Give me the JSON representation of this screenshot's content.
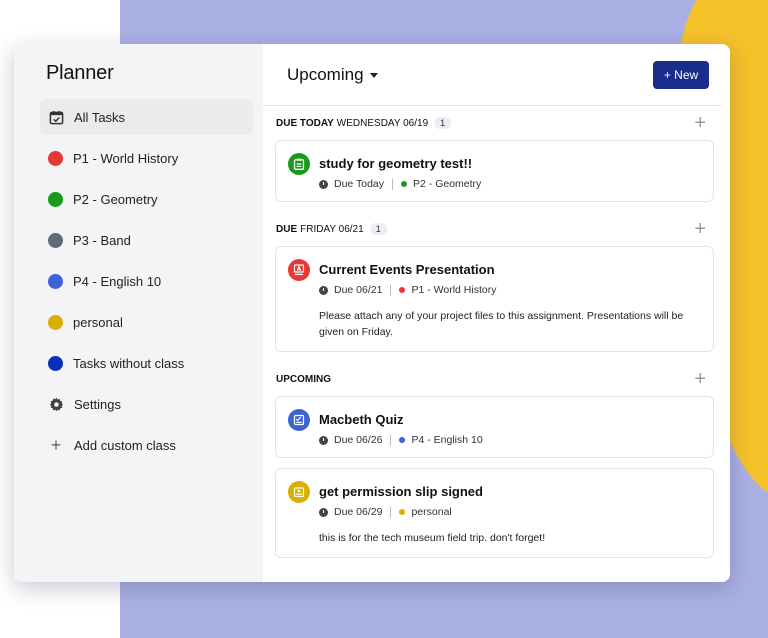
{
  "sidebar": {
    "title": "Planner",
    "items": [
      {
        "label": "All Tasks",
        "icon": "calendar-check-icon",
        "active": true
      },
      {
        "label": "P1 - World History",
        "color": "#e53935"
      },
      {
        "label": "P2 - Geometry",
        "color": "#1a9a1a"
      },
      {
        "label": "P3 - Band",
        "color": "#5f6b7a"
      },
      {
        "label": "P4 - English 10",
        "color": "#3b63d6"
      },
      {
        "label": "personal",
        "color": "#d9b000"
      },
      {
        "label": "Tasks without class",
        "color": "#0b2fb8"
      },
      {
        "label": "Settings",
        "icon": "gear-icon"
      },
      {
        "label": "Add custom class",
        "icon": "plus-icon"
      }
    ]
  },
  "header": {
    "view_label": "Upcoming",
    "new_button": "+ New"
  },
  "sections": [
    {
      "title_bold": "DUE TODAY",
      "title_rest": "WEDNESDAY 06/19",
      "count": "1",
      "tasks": [
        {
          "title": "study for geometry test!!",
          "due": "Due Today",
          "class": "P2 - Geometry",
          "color": "#1a9a1a",
          "icon": "clipboard-icon"
        }
      ]
    },
    {
      "title_bold": "DUE",
      "title_rest": "FRIDAY 06/21",
      "count": "1",
      "tasks": [
        {
          "title": "Current Events Presentation",
          "due": "Due 06/21",
          "class": "P1 - World History",
          "color": "#e53935",
          "icon": "presentation-icon",
          "description": "Please attach any of your project files to this assignment. Presentations will be given on Friday."
        }
      ]
    },
    {
      "title_bold": "UPCOMING",
      "tasks": [
        {
          "title": "Macbeth Quiz",
          "due": "Due 06/26",
          "class": "P4 - English 10",
          "color": "#3b63d6",
          "icon": "quiz-icon"
        },
        {
          "title": "get permission slip signed",
          "due": "Due 06/29",
          "class": "personal",
          "color": "#d9b000",
          "icon": "document-icon",
          "description": "this is for the tech museum field trip. don't forget!"
        }
      ]
    }
  ]
}
